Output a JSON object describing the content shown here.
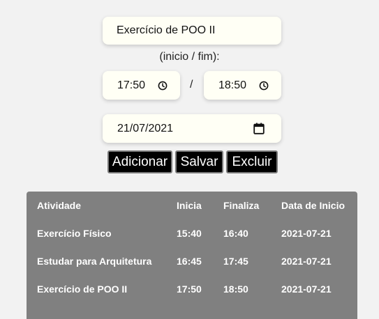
{
  "form": {
    "activity_value": "Exercício de POO II",
    "range_label": "(inicio / fim):",
    "time_start": "17:50",
    "separator": "/",
    "time_end": "18:50",
    "date_value": "21/07/2021",
    "icons": {
      "time": "clock-icon",
      "date": "calendar-icon"
    }
  },
  "buttons": {
    "add_label": "Adicionar",
    "save_label": "Salvar",
    "delete_label": "Excluir"
  },
  "table": {
    "headers": [
      "Atividade",
      "Inicia",
      "Finaliza",
      "Data de Inicio"
    ],
    "rows": [
      [
        "Exercício Físico",
        "15:40",
        "16:40",
        "2021-07-21"
      ],
      [
        "Estudar para Arquitetura",
        "16:45",
        "17:45",
        "2021-07-21"
      ],
      [
        "Exercício de POO II",
        "17:50",
        "18:50",
        "2021-07-21"
      ]
    ]
  },
  "colors": {
    "page_bg": "#f2f2f2",
    "field_bg": "#fffff5",
    "button_bg": "#000000",
    "table_bg": "#808080"
  }
}
